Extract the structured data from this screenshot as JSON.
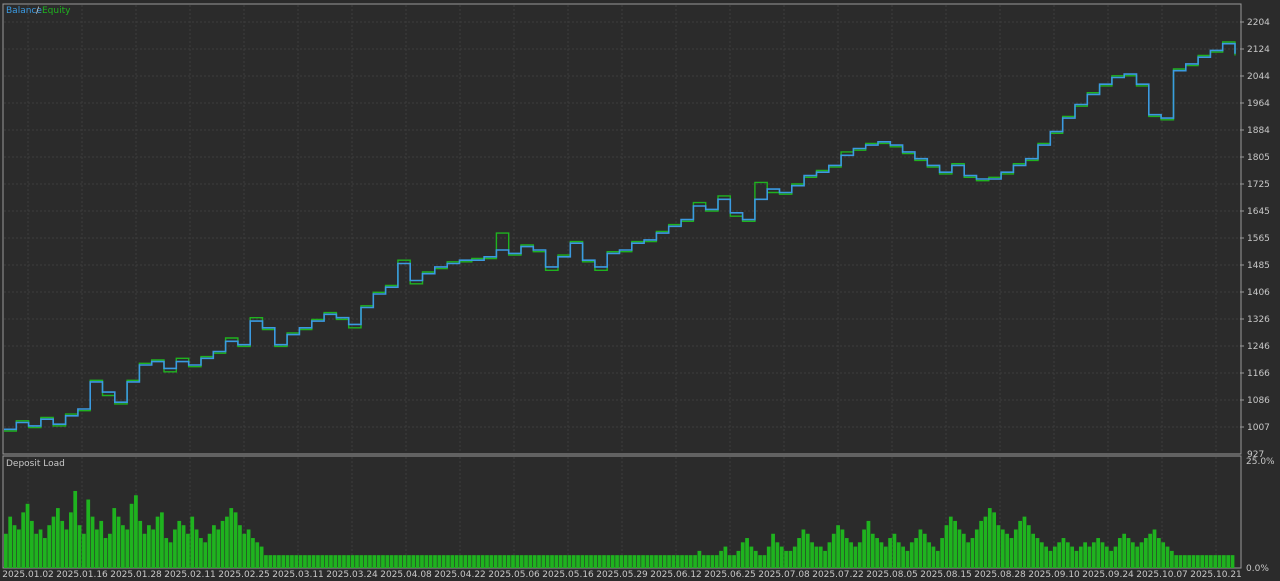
{
  "chart_data": [
    {
      "type": "line",
      "legend": {
        "items": [
          {
            "label": "Balance",
            "color": "#3b9ae1"
          },
          {
            "label": "Equity",
            "color": "#1fb31f"
          }
        ],
        "separator": "/",
        "position": "top-left"
      },
      "yticks": [
        "2204",
        "2124",
        "2044",
        "1964",
        "1884",
        "1805",
        "1725",
        "1645",
        "1565",
        "1485",
        "1406",
        "1326",
        "1246",
        "1166",
        "1086",
        "1007",
        "927"
      ],
      "ylim": [
        927,
        2204
      ],
      "xlim": [
        0,
        10
      ],
      "grid": true,
      "series": [
        {
          "name": "Balance",
          "color": "#3b9ae1",
          "x": [
            0,
            0.1,
            0.2,
            0.3,
            0.4,
            0.5,
            0.6,
            0.7,
            0.8,
            0.9,
            1.0,
            1.1,
            1.2,
            1.3,
            1.4,
            1.5,
            1.6,
            1.7,
            1.8,
            1.9,
            2.0,
            2.1,
            2.2,
            2.3,
            2.4,
            2.5,
            2.6,
            2.7,
            2.8,
            2.9,
            3.0,
            3.1,
            3.2,
            3.3,
            3.4,
            3.5,
            3.6,
            3.7,
            3.8,
            3.9,
            4.0,
            4.1,
            4.2,
            4.3,
            4.4,
            4.5,
            4.6,
            4.7,
            4.8,
            4.9,
            5.0,
            5.1,
            5.2,
            5.3,
            5.4,
            5.5,
            5.6,
            5.7,
            5.8,
            5.9,
            6.0,
            6.1,
            6.2,
            6.3,
            6.4,
            6.5,
            6.6,
            6.7,
            6.8,
            6.9,
            7.0,
            7.1,
            7.2,
            7.3,
            7.4,
            7.5,
            7.6,
            7.7,
            7.8,
            7.9,
            8.0,
            8.1,
            8.2,
            8.3,
            8.4,
            8.5,
            8.6,
            8.7,
            8.8,
            8.9,
            9.0,
            9.1,
            9.2,
            9.3,
            9.4,
            9.5,
            9.6,
            9.7,
            9.8,
            9.9,
            10.0
          ],
          "values": [
            1000,
            1020,
            1010,
            1030,
            1015,
            1040,
            1060,
            1140,
            1110,
            1080,
            1140,
            1190,
            1200,
            1180,
            1200,
            1190,
            1210,
            1230,
            1260,
            1250,
            1320,
            1300,
            1250,
            1280,
            1300,
            1320,
            1340,
            1330,
            1310,
            1360,
            1400,
            1420,
            1490,
            1440,
            1460,
            1480,
            1490,
            1500,
            1500,
            1510,
            1530,
            1520,
            1540,
            1530,
            1480,
            1510,
            1550,
            1500,
            1480,
            1520,
            1530,
            1550,
            1560,
            1580,
            1600,
            1620,
            1660,
            1650,
            1680,
            1640,
            1620,
            1680,
            1710,
            1700,
            1720,
            1750,
            1760,
            1780,
            1810,
            1830,
            1840,
            1850,
            1840,
            1820,
            1800,
            1780,
            1760,
            1780,
            1750,
            1740,
            1740,
            1760,
            1780,
            1800,
            1840,
            1880,
            1920,
            1960,
            1990,
            2020,
            2040,
            2050,
            2020,
            1930,
            1920,
            2060,
            2080,
            2100,
            2120,
            2140,
            2110
          ]
        },
        {
          "name": "Equity",
          "color": "#1fb31f",
          "x": [
            0,
            0.1,
            0.2,
            0.3,
            0.4,
            0.5,
            0.6,
            0.7,
            0.8,
            0.9,
            1.0,
            1.1,
            1.2,
            1.3,
            1.4,
            1.5,
            1.6,
            1.7,
            1.8,
            1.9,
            2.0,
            2.1,
            2.2,
            2.3,
            2.4,
            2.5,
            2.6,
            2.7,
            2.8,
            2.9,
            3.0,
            3.1,
            3.2,
            3.3,
            3.4,
            3.5,
            3.6,
            3.7,
            3.8,
            3.9,
            4.0,
            4.1,
            4.2,
            4.3,
            4.4,
            4.5,
            4.6,
            4.7,
            4.8,
            4.9,
            5.0,
            5.1,
            5.2,
            5.3,
            5.4,
            5.5,
            5.6,
            5.7,
            5.8,
            5.9,
            6.0,
            6.1,
            6.2,
            6.3,
            6.4,
            6.5,
            6.6,
            6.7,
            6.8,
            6.9,
            7.0,
            7.1,
            7.2,
            7.3,
            7.4,
            7.5,
            7.6,
            7.7,
            7.8,
            7.9,
            8.0,
            8.1,
            8.2,
            8.3,
            8.4,
            8.5,
            8.6,
            8.7,
            8.8,
            8.9,
            9.0,
            9.1,
            9.2,
            9.3,
            9.4,
            9.5,
            9.6,
            9.7,
            9.8,
            9.9,
            10.0
          ],
          "values": [
            995,
            1025,
            1005,
            1035,
            1010,
            1045,
            1055,
            1145,
            1100,
            1075,
            1145,
            1195,
            1205,
            1170,
            1210,
            1185,
            1215,
            1225,
            1270,
            1245,
            1330,
            1295,
            1245,
            1285,
            1295,
            1325,
            1345,
            1325,
            1300,
            1365,
            1405,
            1425,
            1500,
            1430,
            1465,
            1475,
            1495,
            1495,
            1505,
            1505,
            1580,
            1515,
            1545,
            1525,
            1470,
            1515,
            1555,
            1495,
            1470,
            1525,
            1525,
            1555,
            1555,
            1585,
            1605,
            1615,
            1670,
            1645,
            1690,
            1630,
            1615,
            1730,
            1700,
            1695,
            1725,
            1745,
            1765,
            1775,
            1820,
            1825,
            1845,
            1845,
            1835,
            1815,
            1795,
            1775,
            1755,
            1785,
            1745,
            1735,
            1745,
            1755,
            1785,
            1795,
            1845,
            1875,
            1925,
            1955,
            1995,
            2015,
            2045,
            2045,
            2015,
            1925,
            1915,
            2065,
            2075,
            2105,
            2115,
            2145,
            2105
          ]
        }
      ]
    },
    {
      "type": "bar",
      "title": "Deposit Load",
      "ylim": [
        0,
        25
      ],
      "yticks": [
        "25.0%",
        "0.0%"
      ],
      "xticks": [
        "2025.01.02",
        "2025.01.16",
        "2025.01.28",
        "2025.02.11",
        "2025.02.25",
        "2025.03.11",
        "2025.03.24",
        "2025.04.08",
        "2025.04.22",
        "2025.05.06",
        "2025.05.16",
        "2025.05.29",
        "2025.06.12",
        "2025.06.25",
        "2025.07.08",
        "2025.07.22",
        "2025.08.05",
        "2025.08.15",
        "2025.08.28",
        "2025.09.10",
        "2025.09.24",
        "2025.10.07",
        "2025.10.21"
      ],
      "color": "#1fb31f",
      "values": [
        8,
        12,
        10,
        9,
        13,
        15,
        11,
        8,
        9,
        7,
        10,
        12,
        14,
        11,
        9,
        13,
        18,
        10,
        8,
        16,
        12,
        9,
        11,
        7,
        8,
        14,
        12,
        10,
        9,
        15,
        17,
        11,
        8,
        10,
        9,
        12,
        13,
        7,
        6,
        9,
        11,
        10,
        8,
        12,
        9,
        7,
        6,
        8,
        10,
        9,
        11,
        12,
        14,
        13,
        10,
        8,
        9,
        7,
        6,
        5,
        3,
        3,
        3,
        3,
        3,
        3,
        3,
        3,
        3,
        3,
        3,
        3,
        3,
        3,
        3,
        3,
        3,
        3,
        3,
        3,
        3,
        3,
        3,
        3,
        3,
        3,
        3,
        3,
        3,
        3,
        3,
        3,
        3,
        3,
        3,
        3,
        3,
        3,
        3,
        3,
        3,
        3,
        3,
        3,
        3,
        3,
        3,
        3,
        3,
        3,
        3,
        3,
        3,
        3,
        3,
        3,
        3,
        3,
        3,
        3,
        3,
        3,
        3,
        3,
        3,
        3,
        3,
        3,
        3,
        3,
        3,
        3,
        3,
        3,
        3,
        3,
        3,
        3,
        3,
        3,
        3,
        3,
        3,
        3,
        3,
        3,
        3,
        3,
        3,
        3,
        3,
        3,
        3,
        3,
        3,
        3,
        3,
        3,
        3,
        3,
        4,
        3,
        3,
        3,
        3,
        4,
        5,
        3,
        3,
        4,
        6,
        7,
        5,
        4,
        3,
        3,
        5,
        8,
        6,
        5,
        4,
        4,
        5,
        7,
        9,
        8,
        6,
        5,
        5,
        4,
        6,
        8,
        10,
        9,
        7,
        6,
        5,
        6,
        9,
        11,
        8,
        7,
        6,
        5,
        7,
        8,
        6,
        5,
        4,
        6,
        7,
        9,
        8,
        6,
        5,
        4,
        7,
        10,
        12,
        11,
        9,
        8,
        6,
        7,
        9,
        11,
        12,
        14,
        13,
        10,
        9,
        8,
        7,
        9,
        11,
        12,
        10,
        8,
        7,
        6,
        5,
        4,
        5,
        6,
        7,
        6,
        5,
        4,
        5,
        6,
        5,
        6,
        7,
        6,
        5,
        4,
        5,
        7,
        8,
        7,
        6,
        5,
        6,
        7,
        8,
        9,
        7,
        6,
        5,
        4,
        3,
        3,
        3,
        3,
        3,
        3,
        3,
        3,
        3,
        3,
        3,
        3,
        3,
        3
      ]
    }
  ]
}
